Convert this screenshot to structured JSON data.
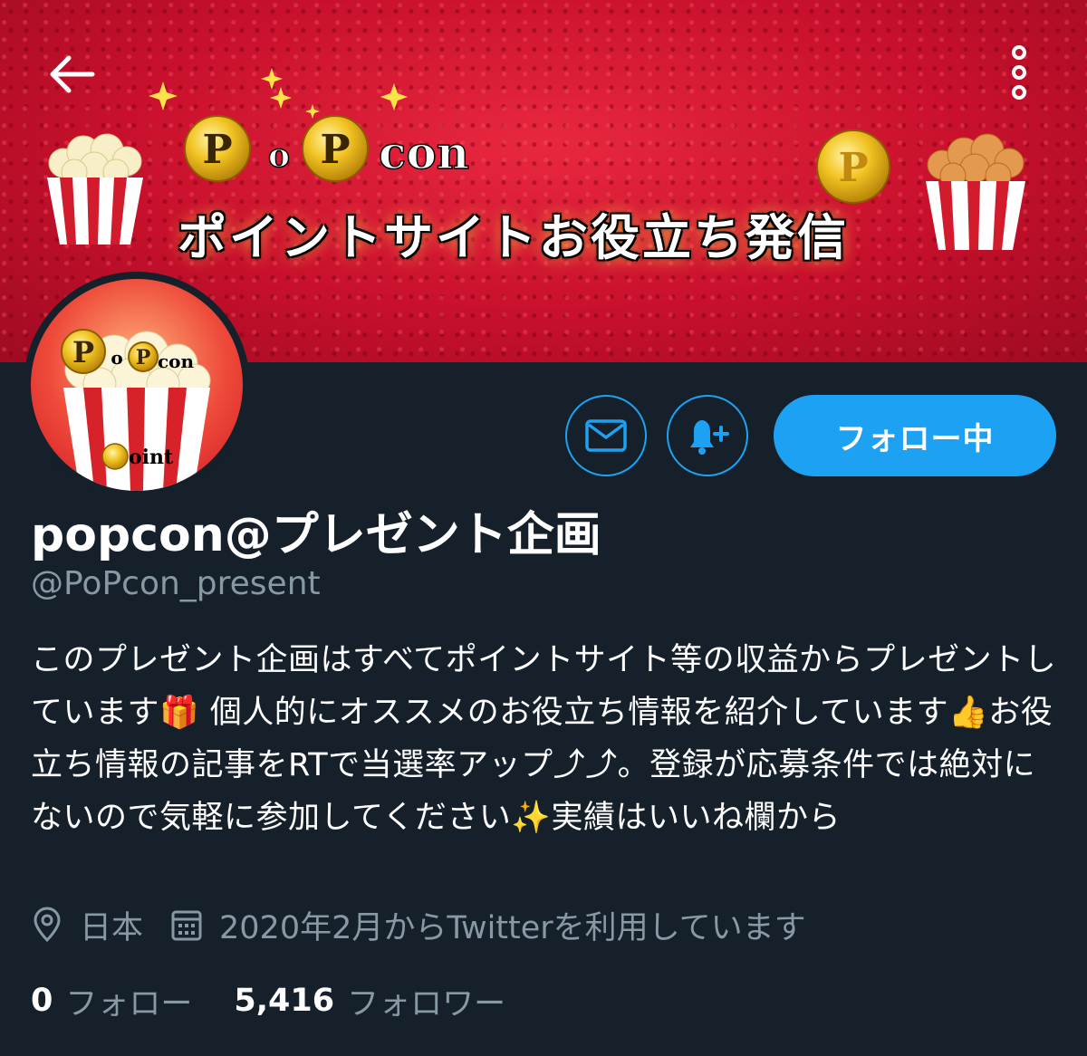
{
  "banner": {
    "title_parts": [
      "P",
      "o",
      "P",
      "con"
    ],
    "subtitle": "ポイントサイトお役立ち発信",
    "coin_letter": "P"
  },
  "avatar": {
    "logo_parts": [
      "P",
      "o",
      "P",
      "con"
    ],
    "bottom_text": "oint"
  },
  "actions": {
    "follow_label": "フォロー中"
  },
  "profile": {
    "display_name": "popcon@プレゼント企画",
    "handle": "@PoPcon_present",
    "bio_1": "このプレゼント企画はすべてポイントサイト等の収益からプレゼントしています",
    "bio_emoji_gift": "🎁",
    "bio_2": " 個人的にオススメのお役立ち情報を紹介しています",
    "bio_emoji_thumb": "👍",
    "bio_3": "お役立ち情報の記事をRTで当選率アップ⤴︎⤴︎。登録が応募条件では絶対にないので気軽に参加してください",
    "bio_emoji_sparkle": "✨",
    "bio_4": "実績はいいね欄から",
    "location": "日本",
    "joined": "2020年2月からTwitterを利用しています",
    "following_count": "0",
    "following_label": "フォロー",
    "followers_count": "5,416",
    "followers_label": "フォロワー"
  },
  "colors": {
    "background": "#15202b",
    "accent": "#1da1f2",
    "secondary_text": "#8899a6",
    "banner_red": "#c8102c"
  },
  "icons": [
    "back-arrow-icon",
    "more-vertical-icon",
    "mail-icon",
    "bell-plus-icon",
    "location-pin-icon",
    "calendar-icon"
  ]
}
